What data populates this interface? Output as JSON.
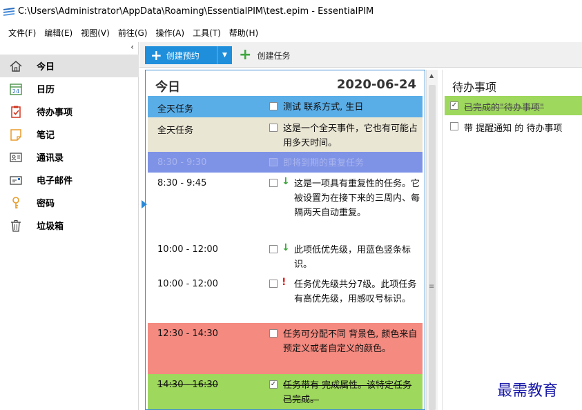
{
  "window": {
    "title": "C:\\Users\\Administrator\\AppData\\Roaming\\EssentialPIM\\test.epim - EssentialPIM",
    "icon": "app-menu-icon"
  },
  "menu": [
    "文件(F)",
    "编辑(E)",
    "视图(V)",
    "前往(G)",
    "操作(A)",
    "工具(T)",
    "帮助(H)"
  ],
  "sidebar": {
    "collapse_glyph": "‹",
    "items": [
      {
        "label": "今日",
        "icon": "home-icon",
        "active": true
      },
      {
        "label": "日历",
        "icon": "calendar-icon",
        "icon_text": "24"
      },
      {
        "label": "待办事项",
        "icon": "checklist-icon"
      },
      {
        "label": "笔记",
        "icon": "note-icon"
      },
      {
        "label": "通讯录",
        "icon": "contact-card-icon"
      },
      {
        "label": "电子邮件",
        "icon": "mail-icon"
      },
      {
        "label": "密码",
        "icon": "key-icon"
      },
      {
        "label": "垃圾箱",
        "icon": "trash-icon"
      }
    ]
  },
  "toolbar": {
    "new_appointment": "创建预约",
    "new_task": "创建任务"
  },
  "day_view": {
    "title": "今日",
    "date": "2020-06-24",
    "events": [
      {
        "time": "全天任务",
        "text": "测试 联系方式, 生日",
        "bg": "#5aaee8",
        "checked": false,
        "priority": ""
      },
      {
        "time": "全天任务",
        "text": "这是一个全天事件，它也有可能占用多天时间。",
        "bg": "#eae6d4",
        "checked": false,
        "priority": ""
      },
      {
        "time": "8:30 - 9:30",
        "text": "即将到期的重复任务",
        "bg": "#7f93e6",
        "checked": false,
        "priority": "",
        "faded": true
      },
      {
        "time": "8:30 - 9:45",
        "text": "这是一项具有重复性的任务。它被设置为在接下来的三周内、每隔两天自动重复。",
        "bg": "#ffffff",
        "checked": false,
        "priority": "↓",
        "priority_color": "#3aa63a"
      },
      {
        "time": "10:00 - 12:00",
        "text": "此项低优先级，用蓝色竖条标识。",
        "bg": "#ffffff",
        "checked": false,
        "priority": "↓",
        "priority_color": "#3aa63a"
      },
      {
        "time": "10:00 - 12:00",
        "text": "任务优先级共分7级。此项任务有高优先级，用感叹号标识。",
        "bg": "#ffffff",
        "checked": false,
        "priority": "!",
        "priority_color": "#e02020"
      },
      {
        "time": "12:30 - 14:30",
        "text": "任务可分配不同 背景色, 颜色来自预定义或者自定义的颜色。",
        "bg": "#f48a80",
        "checked": false,
        "priority": ""
      },
      {
        "time": "14:30 - 16:30",
        "text": "任务带有 完成属性。该特定任务已完成。",
        "bg": "#9ed85d",
        "checked": true,
        "priority": "",
        "strike": true
      }
    ]
  },
  "todo": {
    "title": "待办事项",
    "items": [
      {
        "text": "已完成的\"待办事项\"",
        "checked": true,
        "done": true
      },
      {
        "text": "带 提醒通知 的 待办事项",
        "checked": false,
        "done": false
      }
    ]
  },
  "watermark": "最需教育"
}
